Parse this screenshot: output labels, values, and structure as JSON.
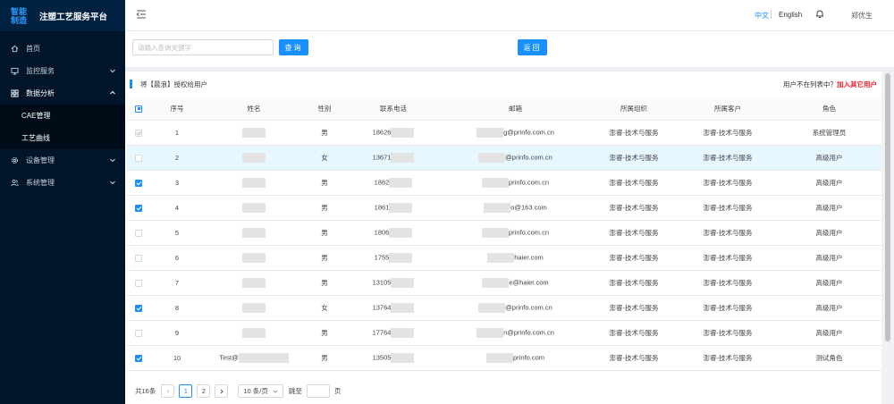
{
  "app": {
    "logo_line1": "智能",
    "logo_line2": "制造",
    "title": "注塑工艺服务平台"
  },
  "sidebar": {
    "items": [
      {
        "label": "首页",
        "icon": "home-icon"
      },
      {
        "label": "监控服务",
        "icon": "monitor-icon"
      },
      {
        "label": "数据分析",
        "icon": "grid-icon"
      },
      {
        "label": "CAE管理"
      },
      {
        "label": "工艺曲线"
      },
      {
        "label": "设备管理",
        "icon": "gear-icon"
      },
      {
        "label": "系统管理",
        "icon": "users-icon"
      }
    ]
  },
  "header": {
    "lang_zh": "中文",
    "lang_en": "English",
    "user": "郑优生"
  },
  "search": {
    "placeholder": "请输入查询关键字",
    "query_label": "查询",
    "back_label": "返回"
  },
  "card": {
    "title": "将【晨浪】授权给用户",
    "notice_text": "用户不在列表中？",
    "notice_link": "加入其它用户"
  },
  "table": {
    "columns": [
      "序号",
      "姓名",
      "性别",
      "联系电话",
      "邮箱",
      "所属组织",
      "所属客户",
      "角色"
    ],
    "rows": [
      {
        "no": "1",
        "name": "",
        "gender": "男",
        "phone": "18626",
        "email": "g@prinfo.com.cn",
        "org": "澎睿-技术与服务",
        "customer": "澎睿-技术与服务",
        "role": "系统管理员",
        "check": "disabled"
      },
      {
        "no": "2",
        "name": "",
        "gender": "女",
        "phone": "13671",
        "email": "@prinfo.com.cn",
        "org": "澎睿-技术与服务",
        "customer": "澎睿-技术与服务",
        "role": "高级用户",
        "check": "off"
      },
      {
        "no": "3",
        "name": "",
        "gender": "男",
        "phone": "1862",
        "email": "prinfo.com.cn",
        "org": "澎睿-技术与服务",
        "customer": "澎睿-技术与服务",
        "role": "高级用户",
        "check": "on"
      },
      {
        "no": "4",
        "name": "",
        "gender": "男",
        "phone": "1861",
        "email": "o@163.com",
        "org": "澎睿-技术与服务",
        "customer": "澎睿-技术与服务",
        "role": "高级用户",
        "check": "on"
      },
      {
        "no": "5",
        "name": "",
        "gender": "男",
        "phone": "1806",
        "email": "prinfo.com.cn",
        "org": "澎睿-技术与服务",
        "customer": "澎睿-技术与服务",
        "role": "高级用户",
        "check": "off"
      },
      {
        "no": "6",
        "name": "",
        "gender": "男",
        "phone": "1755",
        "email": "haier.com",
        "org": "澎睿-技术与服务",
        "customer": "澎睿-技术与服务",
        "role": "高级用户",
        "check": "off"
      },
      {
        "no": "7",
        "name": "",
        "gender": "男",
        "phone": "13105",
        "email": "e@haier.com",
        "org": "澎睿-技术与服务",
        "customer": "澎睿-技术与服务",
        "role": "高级用户",
        "check": "off"
      },
      {
        "no": "8",
        "name": "",
        "gender": "女",
        "phone": "13764",
        "email": "@prinfo.com.cn",
        "org": "澎睿-技术与服务",
        "customer": "澎睿-技术与服务",
        "role": "高级用户",
        "check": "on"
      },
      {
        "no": "9",
        "name": "",
        "gender": "男",
        "phone": "17764",
        "email": "n@prinfo.com.cn",
        "org": "澎睿-技术与服务",
        "customer": "澎睿-技术与服务",
        "role": "高级用户",
        "check": "off"
      },
      {
        "no": "10",
        "name": "Test@",
        "gender": "男",
        "phone": "13505",
        "email": "prinfo.com",
        "org": "澎睿-技术与服务",
        "customer": "澎睿-技术与服务",
        "role": "测试角色",
        "check": "on"
      }
    ]
  },
  "pagination": {
    "total": "共16条",
    "pages": [
      "1",
      "2"
    ],
    "page_size": "10 条/页",
    "jump_prefix": "跳至",
    "jump_suffix": "页"
  }
}
